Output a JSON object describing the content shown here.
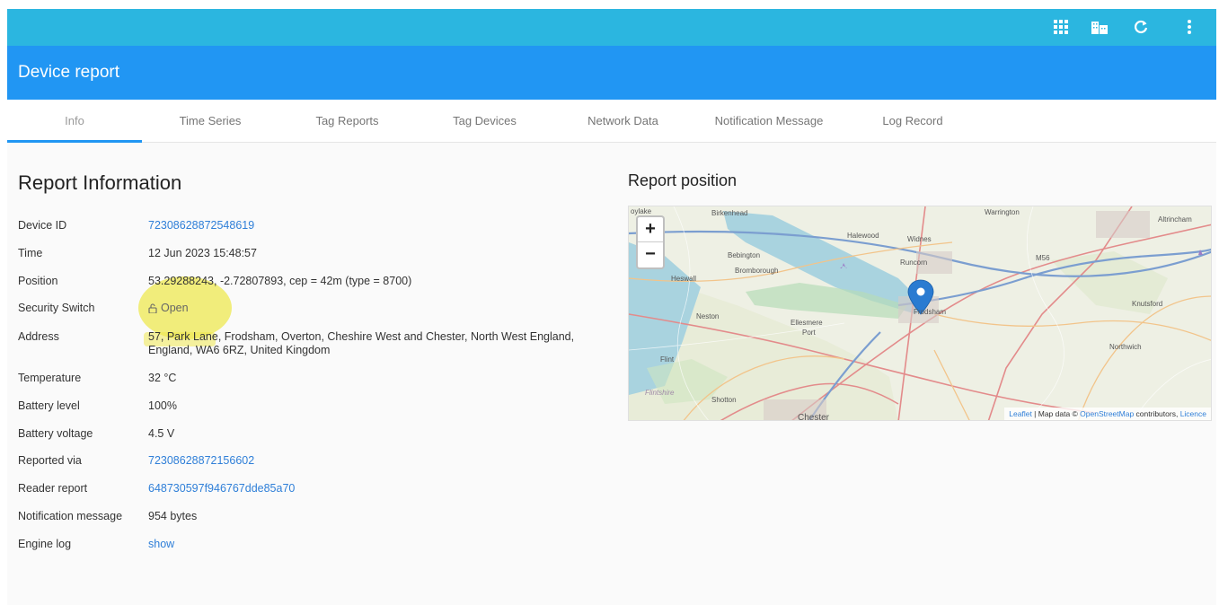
{
  "topbar": {
    "icons": [
      "grid-icon",
      "buildings-icon",
      "refresh-icon",
      "more-vert-icon"
    ],
    "color": "#2bb6e0"
  },
  "appbar": {
    "title": "Device report",
    "color": "#2196f3"
  },
  "tabs": [
    {
      "label": "Info",
      "active": true
    },
    {
      "label": "Time Series"
    },
    {
      "label": "Tag Reports"
    },
    {
      "label": "Tag Devices"
    },
    {
      "label": "Network Data"
    },
    {
      "label": "Notification Message"
    },
    {
      "label": "Log Record"
    }
  ],
  "info": {
    "title": "Report Information",
    "rows": [
      {
        "label": "Device ID",
        "value": "72308628872548619"
      },
      {
        "label": "Time",
        "value": "12 Jun 2023 15:48:57"
      },
      {
        "label": "Position",
        "value": "53.29288243, -2.72807893, cep = 42m (type = 8700)"
      },
      {
        "label": "Security Switch",
        "value": "Open"
      },
      {
        "label": "Address",
        "value": "57, Park Lane, Frodsham, Overton, Cheshire West and Chester, North West England,",
        "value2": "England, WA6 6RZ, United Kingdom"
      },
      {
        "label": "Temperature",
        "value": "32 °C"
      },
      {
        "label": "Battery level",
        "value": "100%"
      },
      {
        "label": "Battery voltage",
        "value": "4.5 V"
      },
      {
        "label": "Reported via",
        "value": "72308628872156602"
      },
      {
        "label": "Reader report",
        "value": "648730597f946767dde85a70"
      },
      {
        "label": "Notification message",
        "value": "954 bytes"
      },
      {
        "label": "Engine log",
        "value": "show"
      }
    ]
  },
  "map": {
    "title": "Report position",
    "zoom_in": "+",
    "zoom_out": "−",
    "attribution": {
      "leaflet": "Leaflet",
      "sep": " | Map data © ",
      "osm": "OpenStreetMap",
      "contrib": " contributors, ",
      "licence": "Licence"
    },
    "labels": {
      "hoylake": "oylake",
      "birkenhead": "Birkenhead",
      "warrington": "Warrington",
      "altrincham": "Altrincham",
      "halewood": "Halewood",
      "widnes": "Widnes",
      "bebington": "Bebington",
      "bromborough": "Bromborough",
      "runcorn": "Runcorn",
      "m56": "M56",
      "heswall": "Heswall",
      "neston": "Neston",
      "ellesmere": "Ellesmere",
      "port": "Port",
      "frodsham": "Frodsham",
      "knutsford": "Knutsford",
      "northwich": "Northwich",
      "flint": "Flint",
      "flintshire": "Flintshire",
      "shotton": "Shotton",
      "chester": "Chester"
    }
  }
}
